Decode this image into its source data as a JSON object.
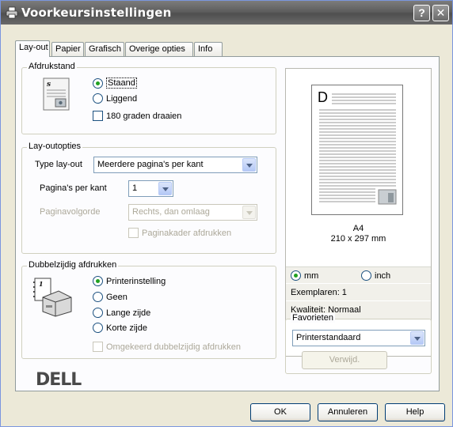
{
  "window": {
    "title": "Voorkeursinstellingen",
    "help_button": "?",
    "close_button": "✕"
  },
  "tabs": [
    {
      "label": "Lay-out",
      "active": true
    },
    {
      "label": "Papier",
      "active": false
    },
    {
      "label": "Grafisch",
      "active": false
    },
    {
      "label": "Overige opties",
      "active": false
    },
    {
      "label": "Info",
      "active": false
    }
  ],
  "orientation": {
    "group_label": "Afdrukstand",
    "options": [
      {
        "label": "Staand",
        "selected": true
      },
      {
        "label": "Liggend",
        "selected": false
      }
    ],
    "rotate_label": "180 graden draaien",
    "rotate_checked": false
  },
  "layout": {
    "group_label": "Lay-outopties",
    "type_label": "Type lay-out",
    "type_value": "Meerdere pagina's per kant",
    "pages_label": "Pagina's per kant",
    "pages_value": "1",
    "order_label": "Paginavolgorde",
    "order_value": "Rechts, dan omlaag",
    "border_label": "Paginakader afdrukken",
    "border_checked": false
  },
  "duplex": {
    "group_label": "Dubbelzijdig afdrukken",
    "options": [
      {
        "label": "Printerinstelling",
        "selected": true
      },
      {
        "label": "Geen",
        "selected": false
      },
      {
        "label": "Lange zijde",
        "selected": false
      },
      {
        "label": "Korte zijde",
        "selected": false
      }
    ],
    "reverse_label": "Omgekeerd dubbelzijdig afdrukken",
    "reverse_checked": false
  },
  "brand": "DELL",
  "preview": {
    "page_letter": "D",
    "paper_name": "A4",
    "paper_size": "210 x 297 mm",
    "units": [
      {
        "label": "mm",
        "selected": true
      },
      {
        "label": "inch",
        "selected": false
      }
    ],
    "copies": "Exemplaren: 1",
    "quality": "Kwaliteit: Normaal"
  },
  "favorites": {
    "group_label": "Favorieten",
    "value": "Printerstandaard",
    "delete_label": "Verwijd."
  },
  "footer": {
    "ok": "OK",
    "cancel": "Annuleren",
    "help": "Help"
  },
  "colors": {
    "titlebar": "#5e5e5e",
    "dialog_bg": "#ece9d8",
    "panel_bg": "#fcfcfe",
    "radio_selected": "#21a121"
  }
}
